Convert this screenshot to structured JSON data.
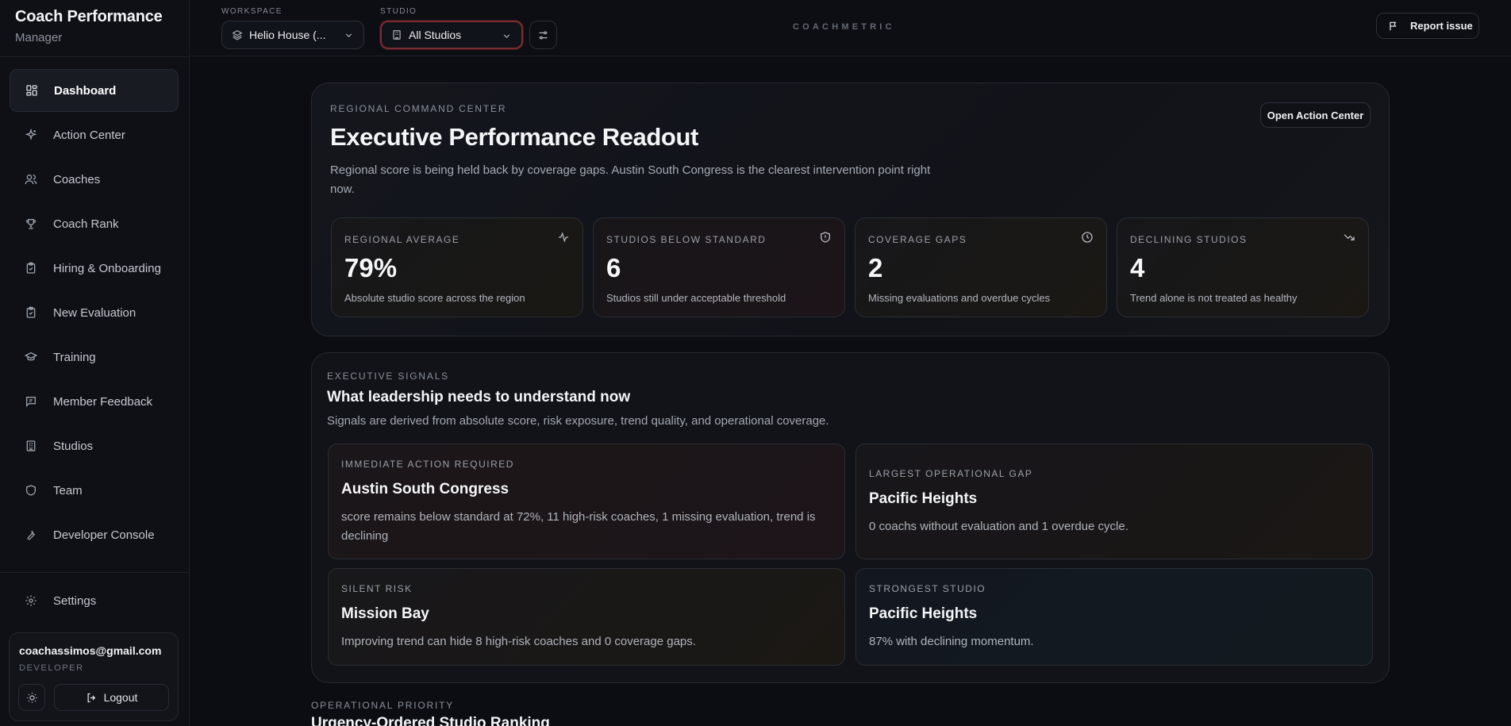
{
  "app": {
    "title": "Coach Performance",
    "role": "Manager"
  },
  "sidebar": {
    "items": [
      {
        "label": "Dashboard",
        "icon": "dashboard-icon",
        "active": true
      },
      {
        "label": "Action Center",
        "icon": "sparkle-icon"
      },
      {
        "label": "Coaches",
        "icon": "users-icon"
      },
      {
        "label": "Coach Rank",
        "icon": "trophy-icon"
      },
      {
        "label": "Hiring & Onboarding",
        "icon": "clipboard-icon"
      },
      {
        "label": "New Evaluation",
        "icon": "clipboard-check-icon"
      },
      {
        "label": "Training",
        "icon": "graduation-cap-icon"
      },
      {
        "label": "Member Feedback",
        "icon": "message-icon"
      },
      {
        "label": "Studios",
        "icon": "building-icon"
      },
      {
        "label": "Team",
        "icon": "shield-icon"
      },
      {
        "label": "Developer Console",
        "icon": "wrench-icon"
      }
    ],
    "settings_label": "Settings",
    "user": {
      "email": "coachassimos@gmail.com",
      "role": "DEVELOPER",
      "logout_label": "Logout"
    }
  },
  "topbar": {
    "workspace_label": "WORKSPACE",
    "workspace_value": "Helio House (...",
    "studio_label": "STUDIO",
    "studio_value": "All Studios",
    "wordmark": "COACHMETRIC",
    "report_label": "Report issue"
  },
  "hero": {
    "eyebrow": "REGIONAL COMMAND CENTER",
    "title": "Executive Performance Readout",
    "description": "Regional score is being held back by coverage gaps. Austin South Congress is the clearest intervention point right now.",
    "button_label": "Open Action Center",
    "kpis": [
      {
        "label": "REGIONAL AVERAGE",
        "value": "79%",
        "note": "Absolute studio score across the region",
        "icon": "activity-icon"
      },
      {
        "label": "STUDIOS BELOW STANDARD",
        "value": "6",
        "note": "Studios still under acceptable threshold",
        "icon": "shield-alert-icon"
      },
      {
        "label": "COVERAGE GAPS",
        "value": "2",
        "note": "Missing evaluations and overdue cycles",
        "icon": "clock-icon"
      },
      {
        "label": "DECLINING STUDIOS",
        "value": "4",
        "note": "Trend alone is not treated as healthy",
        "icon": "trending-down-icon"
      }
    ]
  },
  "signals": {
    "eyebrow": "EXECUTIVE SIGNALS",
    "title": "What leadership needs to understand now",
    "description": "Signals are derived from absolute score, risk exposure, trend quality, and operational coverage.",
    "cards": [
      {
        "label": "IMMEDIATE ACTION REQUIRED",
        "title": "Austin South Congress",
        "body": "score remains below standard at 72%, 11 high-risk coaches, 1 missing evaluation, trend is declining"
      },
      {
        "label": "LARGEST OPERATIONAL GAP",
        "title": "Pacific Heights",
        "body": "0 coachs without evaluation and 1 overdue cycle."
      },
      {
        "label": "SILENT RISK",
        "title": "Mission Bay",
        "body": "Improving trend can hide 8 high-risk coaches and 0 coverage gaps."
      },
      {
        "label": "STRONGEST STUDIO",
        "title": "Pacific Heights",
        "body": "87% with declining momentum."
      }
    ]
  },
  "operational": {
    "eyebrow": "OPERATIONAL PRIORITY",
    "title": "Urgency-Ordered Studio Ranking"
  }
}
